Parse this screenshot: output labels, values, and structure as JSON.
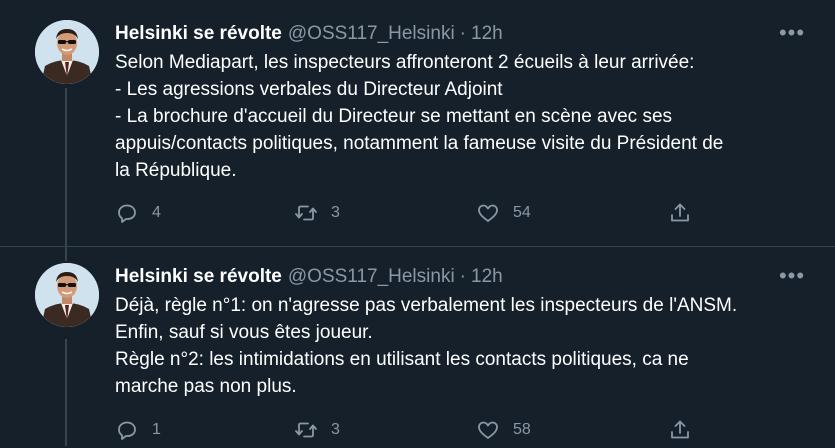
{
  "tweets": [
    {
      "author_name": "Helsinki se révolte",
      "handle": "@OSS117_Helsinki",
      "separator": "·",
      "time": "12h",
      "more_label": "•••",
      "text_lines": [
        "Selon Mediapart, les inspecteurs affronteront 2 écueils à leur arrivée:",
        "- Les agressions verbales du Directeur Adjoint",
        "- La brochure d'accueil du Directeur se mettant en scène avec ses",
        "appuis/contacts politiques, notamment la fameuse visite du Président de",
        "la République."
      ],
      "replies": "4",
      "retweets": "3",
      "likes": "54"
    },
    {
      "author_name": "Helsinki se révolte",
      "handle": "@OSS117_Helsinki",
      "separator": "·",
      "time": "12h",
      "more_label": "•••",
      "text_lines": [
        "Déjà, règle n°1: on n'agresse pas verbalement les inspecteurs de l'ANSM.",
        "Enfin, sauf si vous êtes joueur.",
        "Règle n°2: les intimidations en utilisant les contacts politiques, ca ne",
        "marche pas non plus."
      ],
      "replies": "1",
      "retweets": "3",
      "likes": "58"
    }
  ],
  "theme": {
    "background": "#15202b",
    "text": "#ffffff",
    "secondary": "#8b98a5",
    "divider": "#38444d"
  },
  "icons": [
    "reply-icon",
    "retweet-icon",
    "like-icon",
    "share-icon",
    "more-icon"
  ]
}
